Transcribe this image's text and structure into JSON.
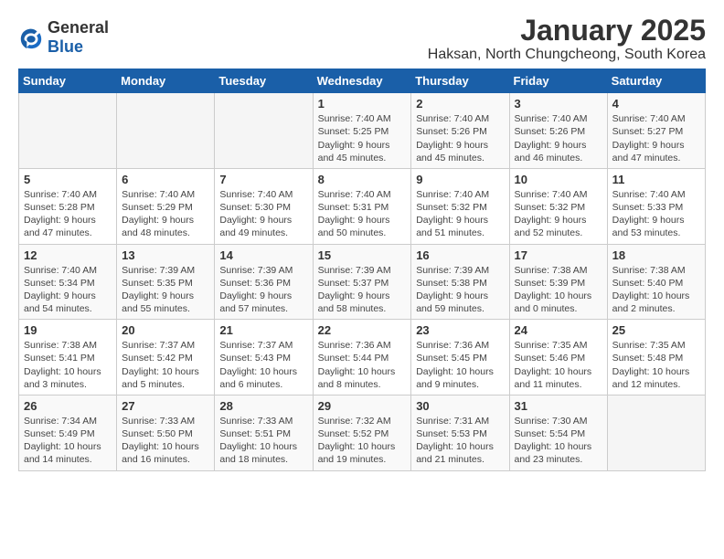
{
  "header": {
    "logo_general": "General",
    "logo_blue": "Blue",
    "title": "January 2025",
    "subtitle": "Haksan, North Chungcheong, South Korea"
  },
  "weekdays": [
    "Sunday",
    "Monday",
    "Tuesday",
    "Wednesday",
    "Thursday",
    "Friday",
    "Saturday"
  ],
  "weeks": [
    [
      {
        "day": "",
        "info": ""
      },
      {
        "day": "",
        "info": ""
      },
      {
        "day": "",
        "info": ""
      },
      {
        "day": "1",
        "info": "Sunrise: 7:40 AM\nSunset: 5:25 PM\nDaylight: 9 hours\nand 45 minutes."
      },
      {
        "day": "2",
        "info": "Sunrise: 7:40 AM\nSunset: 5:26 PM\nDaylight: 9 hours\nand 45 minutes."
      },
      {
        "day": "3",
        "info": "Sunrise: 7:40 AM\nSunset: 5:26 PM\nDaylight: 9 hours\nand 46 minutes."
      },
      {
        "day": "4",
        "info": "Sunrise: 7:40 AM\nSunset: 5:27 PM\nDaylight: 9 hours\nand 47 minutes."
      }
    ],
    [
      {
        "day": "5",
        "info": "Sunrise: 7:40 AM\nSunset: 5:28 PM\nDaylight: 9 hours\nand 47 minutes."
      },
      {
        "day": "6",
        "info": "Sunrise: 7:40 AM\nSunset: 5:29 PM\nDaylight: 9 hours\nand 48 minutes."
      },
      {
        "day": "7",
        "info": "Sunrise: 7:40 AM\nSunset: 5:30 PM\nDaylight: 9 hours\nand 49 minutes."
      },
      {
        "day": "8",
        "info": "Sunrise: 7:40 AM\nSunset: 5:31 PM\nDaylight: 9 hours\nand 50 minutes."
      },
      {
        "day": "9",
        "info": "Sunrise: 7:40 AM\nSunset: 5:32 PM\nDaylight: 9 hours\nand 51 minutes."
      },
      {
        "day": "10",
        "info": "Sunrise: 7:40 AM\nSunset: 5:32 PM\nDaylight: 9 hours\nand 52 minutes."
      },
      {
        "day": "11",
        "info": "Sunrise: 7:40 AM\nSunset: 5:33 PM\nDaylight: 9 hours\nand 53 minutes."
      }
    ],
    [
      {
        "day": "12",
        "info": "Sunrise: 7:40 AM\nSunset: 5:34 PM\nDaylight: 9 hours\nand 54 minutes."
      },
      {
        "day": "13",
        "info": "Sunrise: 7:39 AM\nSunset: 5:35 PM\nDaylight: 9 hours\nand 55 minutes."
      },
      {
        "day": "14",
        "info": "Sunrise: 7:39 AM\nSunset: 5:36 PM\nDaylight: 9 hours\nand 57 minutes."
      },
      {
        "day": "15",
        "info": "Sunrise: 7:39 AM\nSunset: 5:37 PM\nDaylight: 9 hours\nand 58 minutes."
      },
      {
        "day": "16",
        "info": "Sunrise: 7:39 AM\nSunset: 5:38 PM\nDaylight: 9 hours\nand 59 minutes."
      },
      {
        "day": "17",
        "info": "Sunrise: 7:38 AM\nSunset: 5:39 PM\nDaylight: 10 hours\nand 0 minutes."
      },
      {
        "day": "18",
        "info": "Sunrise: 7:38 AM\nSunset: 5:40 PM\nDaylight: 10 hours\nand 2 minutes."
      }
    ],
    [
      {
        "day": "19",
        "info": "Sunrise: 7:38 AM\nSunset: 5:41 PM\nDaylight: 10 hours\nand 3 minutes."
      },
      {
        "day": "20",
        "info": "Sunrise: 7:37 AM\nSunset: 5:42 PM\nDaylight: 10 hours\nand 5 minutes."
      },
      {
        "day": "21",
        "info": "Sunrise: 7:37 AM\nSunset: 5:43 PM\nDaylight: 10 hours\nand 6 minutes."
      },
      {
        "day": "22",
        "info": "Sunrise: 7:36 AM\nSunset: 5:44 PM\nDaylight: 10 hours\nand 8 minutes."
      },
      {
        "day": "23",
        "info": "Sunrise: 7:36 AM\nSunset: 5:45 PM\nDaylight: 10 hours\nand 9 minutes."
      },
      {
        "day": "24",
        "info": "Sunrise: 7:35 AM\nSunset: 5:46 PM\nDaylight: 10 hours\nand 11 minutes."
      },
      {
        "day": "25",
        "info": "Sunrise: 7:35 AM\nSunset: 5:48 PM\nDaylight: 10 hours\nand 12 minutes."
      }
    ],
    [
      {
        "day": "26",
        "info": "Sunrise: 7:34 AM\nSunset: 5:49 PM\nDaylight: 10 hours\nand 14 minutes."
      },
      {
        "day": "27",
        "info": "Sunrise: 7:33 AM\nSunset: 5:50 PM\nDaylight: 10 hours\nand 16 minutes."
      },
      {
        "day": "28",
        "info": "Sunrise: 7:33 AM\nSunset: 5:51 PM\nDaylight: 10 hours\nand 18 minutes."
      },
      {
        "day": "29",
        "info": "Sunrise: 7:32 AM\nSunset: 5:52 PM\nDaylight: 10 hours\nand 19 minutes."
      },
      {
        "day": "30",
        "info": "Sunrise: 7:31 AM\nSunset: 5:53 PM\nDaylight: 10 hours\nand 21 minutes."
      },
      {
        "day": "31",
        "info": "Sunrise: 7:30 AM\nSunset: 5:54 PM\nDaylight: 10 hours\nand 23 minutes."
      },
      {
        "day": "",
        "info": ""
      }
    ]
  ]
}
